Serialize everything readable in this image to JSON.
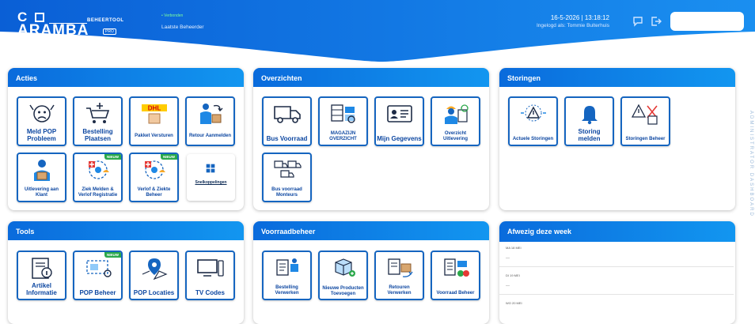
{
  "header": {
    "logo_top": "C",
    "logo_bottom": "ARAMBA",
    "logo_tag": "BEHEERTOOL",
    "logo_pro": "PRO",
    "status": "• Verbonden",
    "user": "Laatste Beheerder",
    "datetime": "16-5-2026 | 13:18:12",
    "logged_in": "Ingelogd als: Tommie Bulterhuis",
    "colors": {
      "primary": "#0a6bdc",
      "accent": "#1296f0"
    }
  },
  "acties": {
    "title": "Acties",
    "tiles": [
      {
        "label": "Meld POP Probleem",
        "icon": "worried-face-icon"
      },
      {
        "label": "Bestelling Plaatsen",
        "icon": "shopping-cart-icon"
      },
      {
        "label": "Pakket Versturen",
        "icon": "dhl-package-icon"
      },
      {
        "label": "Retour Aanmelden",
        "icon": "return-delivery-icon"
      },
      {
        "label": "Uitlevering aan Klant",
        "icon": "courier-icon"
      },
      {
        "label": "Ziek Melden & Verlof Registratie",
        "icon": "sick-leave-icon",
        "badge": "NIEUW"
      },
      {
        "label": "Verlof & Ziekte Beheer",
        "icon": "leave-admin-icon",
        "badge": "NIEUW"
      },
      {
        "label": "Snelkoppelingen",
        "icon": "grid-icon"
      }
    ]
  },
  "overzichten": {
    "title": "Overzichten",
    "tiles": [
      {
        "label": "Bus Voorraad",
        "icon": "truck-icon"
      },
      {
        "label": "MAGAZIJN OVERZICHT",
        "icon": "warehouse-icon"
      },
      {
        "label": "Mijn Gegevens",
        "icon": "id-card-icon"
      },
      {
        "label": "Overzicht Uitlevering",
        "icon": "worker-checklist-icon"
      },
      {
        "label": "Bus voorraad Monteurs",
        "icon": "fleet-icon"
      }
    ]
  },
  "storingen": {
    "title": "Storingen",
    "tiles": [
      {
        "label": "Actuele Storingen",
        "icon": "alert-signal-icon"
      },
      {
        "label": "Storing melden",
        "icon": "bell-icon"
      },
      {
        "label": "Storingen Beheer",
        "icon": "tools-warning-icon"
      }
    ]
  },
  "tools": {
    "title": "Tools",
    "tiles": [
      {
        "label": "Artikel Informatie",
        "icon": "article-info-icon"
      },
      {
        "label": "POP Beheer",
        "icon": "pop-admin-icon",
        "badge": "NIEUW"
      },
      {
        "label": "POP Locaties",
        "icon": "map-pin-icon"
      },
      {
        "label": "TV Codes",
        "icon": "tv-remote-icon"
      }
    ]
  },
  "voorraadbeheer": {
    "title": "Voorraadbeheer",
    "tiles": [
      {
        "label": "Bestelling Verwerken",
        "icon": "order-process-icon"
      },
      {
        "label": "Nieuwe Producten Toevoegen",
        "icon": "new-product-icon"
      },
      {
        "label": "Retouren Verwerken",
        "icon": "returns-process-icon"
      },
      {
        "label": "Voorraad Beheer",
        "icon": "stock-admin-icon"
      }
    ]
  },
  "afwezig": {
    "title": "Afwezig deze week",
    "rows": [
      {
        "day": "MA 18 MEI",
        "value": "—"
      },
      {
        "day": "DI 19 MEI",
        "value": "—"
      },
      {
        "day": "WO 20 MEI",
        "value": ""
      }
    ]
  },
  "side_label": "ADMINISTRATOR DASHBOARD"
}
